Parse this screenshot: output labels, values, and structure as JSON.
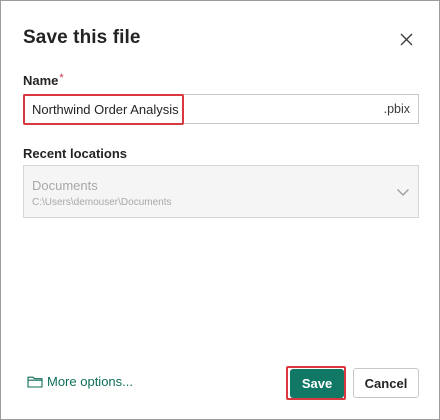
{
  "dialog": {
    "title": "Save this file"
  },
  "name_field": {
    "label": "Name",
    "required_marker": "*",
    "value": "Northwind Order Analysis",
    "extension": ".pbix"
  },
  "recent_locations": {
    "label": "Recent locations",
    "selected_name": "Documents",
    "selected_path": "C:\\Users\\demouser\\Documents"
  },
  "footer": {
    "more_options_label": "More options...",
    "save_label": "Save",
    "cancel_label": "Cancel"
  },
  "colors": {
    "accent": "#117865",
    "link": "#0e6f59",
    "highlight": "#d9383e",
    "required": "#c4314b"
  }
}
